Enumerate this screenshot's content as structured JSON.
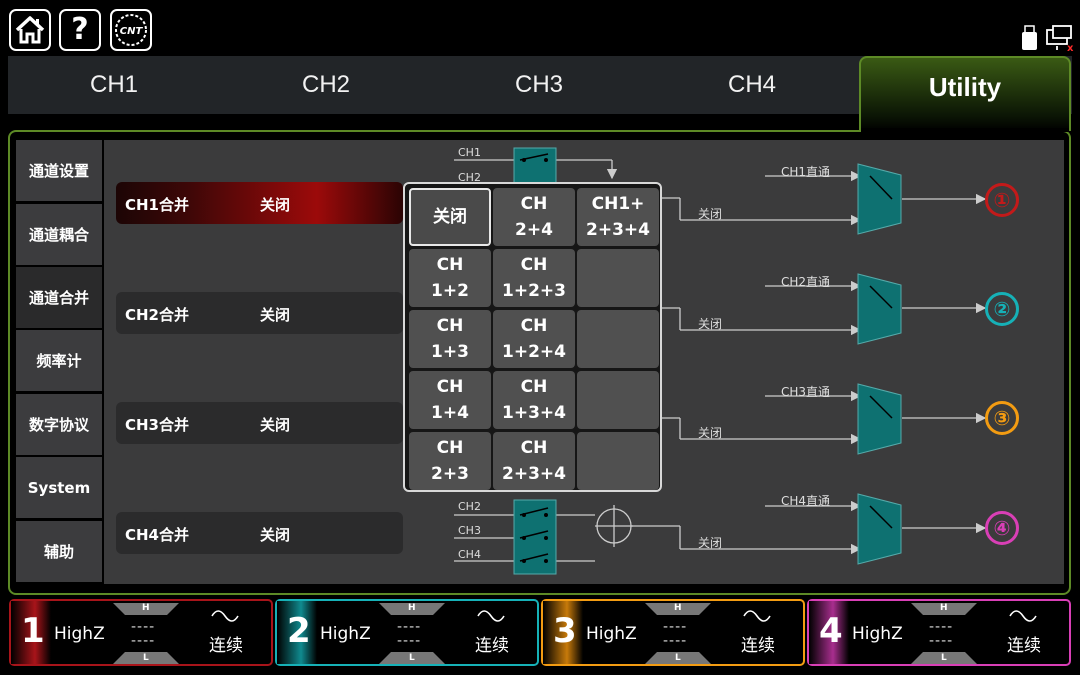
{
  "toolbar": {
    "home": "home-icon",
    "help": "?",
    "logo": "CNT"
  },
  "tabs": [
    "CH1",
    "CH2",
    "CH3",
    "CH4",
    "Utility"
  ],
  "sidebar": [
    "通道设置",
    "通道耦合",
    "通道合并",
    "频率计",
    "数字协议",
    "System",
    "辅助"
  ],
  "merge_rows": [
    {
      "label": "CH1合并",
      "value": "关闭"
    },
    {
      "label": "CH2合并",
      "value": "关闭"
    },
    {
      "label": "CH3合并",
      "value": "关闭"
    },
    {
      "label": "CH4合并",
      "value": "关闭"
    }
  ],
  "popup": {
    "cells": [
      [
        "关闭",
        ""
      ],
      [
        "CH",
        "2+4"
      ],
      [
        "CH1+",
        "2+3+4"
      ],
      [
        "CH",
        "1+2"
      ],
      [
        "CH",
        "1+2+3"
      ],
      [
        "",
        ""
      ],
      [
        "CH",
        "1+3"
      ],
      [
        "CH",
        "1+2+4"
      ],
      [
        "",
        ""
      ],
      [
        "CH",
        "1+4"
      ],
      [
        "CH",
        "1+3+4"
      ],
      [
        "",
        ""
      ],
      [
        "CH",
        "2+3"
      ],
      [
        "CH",
        "2+3+4"
      ],
      [
        "",
        ""
      ]
    ]
  },
  "diagram": {
    "in_labels_top": [
      "CH1",
      "CH2"
    ],
    "in_labels_bottom": [
      "CH2",
      "CH3",
      "CH4"
    ],
    "direct": [
      "CH1直通",
      "CH2直通",
      "CH3直通",
      "CH4直通"
    ],
    "off": [
      "关闭",
      "关闭",
      "关闭",
      "关闭"
    ],
    "outputs": [
      "①",
      "②",
      "③",
      "④"
    ]
  },
  "channels": [
    {
      "num": "1",
      "imp": "HighZ",
      "h": "H",
      "l": "L",
      "d1": "----",
      "d2": "----",
      "mode": "连续",
      "color": "#d01c1c"
    },
    {
      "num": "2",
      "imp": "HighZ",
      "h": "H",
      "l": "L",
      "d1": "----",
      "d2": "----",
      "mode": "连续",
      "color": "#16b1b7"
    },
    {
      "num": "3",
      "imp": "HighZ",
      "h": "H",
      "l": "L",
      "d1": "----",
      "d2": "----",
      "mode": "连续",
      "color": "#f39c12"
    },
    {
      "num": "4",
      "imp": "HighZ",
      "h": "H",
      "l": "L",
      "d1": "----",
      "d2": "----",
      "mode": "连续",
      "color": "#d93fb6"
    }
  ]
}
